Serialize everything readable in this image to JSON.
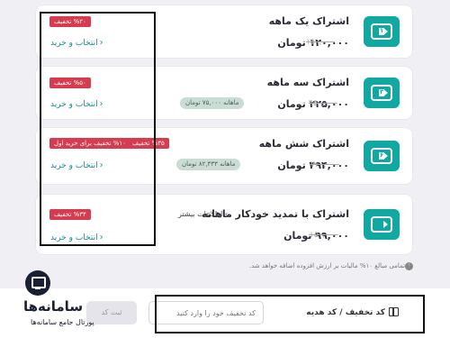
{
  "plans": [
    {
      "title": "اشتراک یک ماهه",
      "icon_number": "۱",
      "price": "۱۲۰,۰۰۰ تومان",
      "old_price": "۱۵۰,۰۰۰",
      "badges": [
        "%۲۰ تخفیف"
      ],
      "buy_label": "انتخاب و خرید"
    },
    {
      "title": "اشتراک سه ماهه",
      "icon_number": "۳",
      "price": "۲۲۵,۰۰۰ تومان",
      "old_price": "۴۵۰,۰۰۰",
      "monthly": "ماهانه ۷۵,۰۰۰ تومان",
      "badges": [
        "%۵۰ تخفیف"
      ],
      "buy_label": "انتخاب و خرید"
    },
    {
      "title": "اشتراک شش ماهه",
      "icon_number": "۶",
      "price": "۴۹۴,۰۰۰ تومان",
      "old_price": "۷۶۰,۰۰۰",
      "monthly": "ماهانه ۸۲,۳۳۳ تومان",
      "badges": [
        "%۳۵ تخفیف",
        "%۱۰ تخفیف برای خرید اول"
      ],
      "buy_label": "انتخاب و خرید"
    },
    {
      "title": "اشتراک با تمدید خودکار ماهانه",
      "more_info": "اطلاعات بیشتر",
      "price": "۹۹,۰۰۰ تومان",
      "old_price": "۱۵۰,۰۰۰",
      "badges": [
        "%۳۴ تخفیف"
      ],
      "buy_label": "انتخاب و خرید"
    }
  ],
  "vat_note": "به تمامی مبالغ ۱۰% مالیات بر ارزش افزوده اضافه خواهد شد.",
  "discount": {
    "label": "کد تخفیف / کد هدیه",
    "placeholder": "کد تخفیف خود را وارد کنید",
    "submit_label": "ثبت کد"
  },
  "watermark": {
    "main": "سامانه‌ها",
    "sub": "پورتال جامع سامانه‌ها"
  },
  "colors": {
    "accent": "#12a8a2",
    "badge": "#d63b4f",
    "link": "#1a8a8a"
  }
}
